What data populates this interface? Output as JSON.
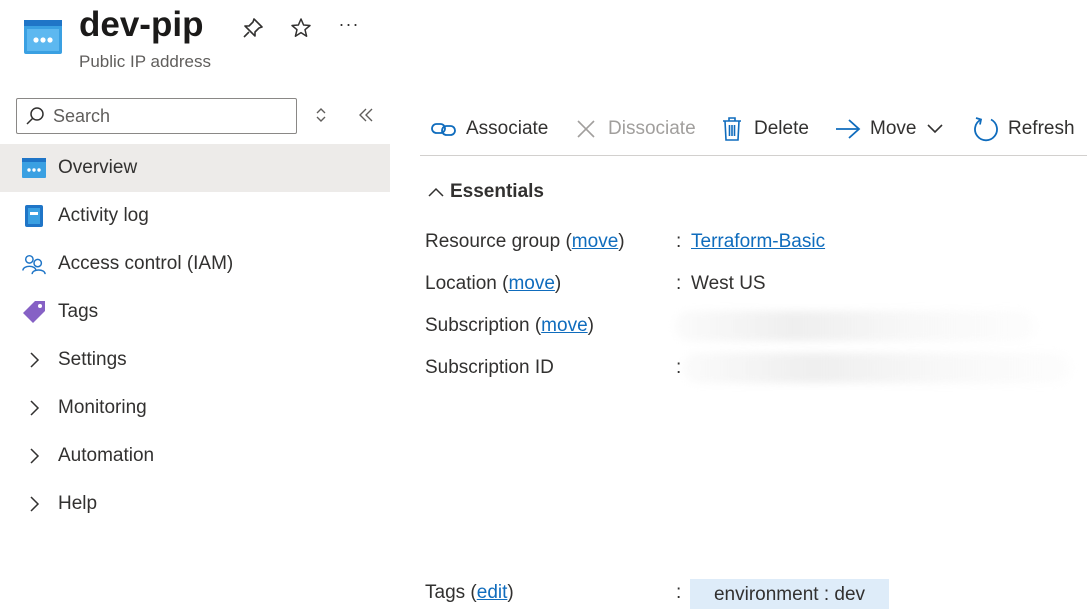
{
  "header": {
    "title": "dev-pip",
    "subtitle": "Public IP address",
    "more_label": "···"
  },
  "sidebar": {
    "search": {
      "placeholder": "Search",
      "value": ""
    },
    "items": [
      {
        "label": "Overview",
        "icon": "public-ip-icon",
        "active": true
      },
      {
        "label": "Activity log",
        "icon": "activity-log-icon"
      },
      {
        "label": "Access control (IAM)",
        "icon": "iam-icon"
      },
      {
        "label": "Tags",
        "icon": "tag-icon"
      },
      {
        "label": "Settings",
        "icon": "chevron-right-icon"
      },
      {
        "label": "Monitoring",
        "icon": "chevron-right-icon"
      },
      {
        "label": "Automation",
        "icon": "chevron-right-icon"
      },
      {
        "label": "Help",
        "icon": "chevron-right-icon"
      }
    ]
  },
  "toolbar": {
    "associate": "Associate",
    "dissociate": "Dissociate",
    "delete": "Delete",
    "move": "Move",
    "refresh": "Refresh"
  },
  "essentials": {
    "heading": "Essentials",
    "rows": {
      "resource_group": {
        "label": "Resource group (",
        "link": "move",
        "close": ")",
        "colon": ":",
        "value": "Terraform-Basic"
      },
      "location": {
        "label": "Location (",
        "link": "move",
        "close": ")",
        "colon": ":",
        "value": "West US"
      },
      "subscription": {
        "label": "Subscription (",
        "link": "move",
        "close": ")"
      },
      "subscription_id": {
        "label": "Subscription ID",
        "colon": ":"
      },
      "tags": {
        "label": "Tags (",
        "link": "edit",
        "close": ")",
        "colon": ":",
        "value": "environment : dev"
      }
    }
  },
  "colors": {
    "accent": "#0f6cbd",
    "active_bg": "#edebe9",
    "tag_bg": "#deecf9",
    "disabled": "#a19f9d"
  }
}
